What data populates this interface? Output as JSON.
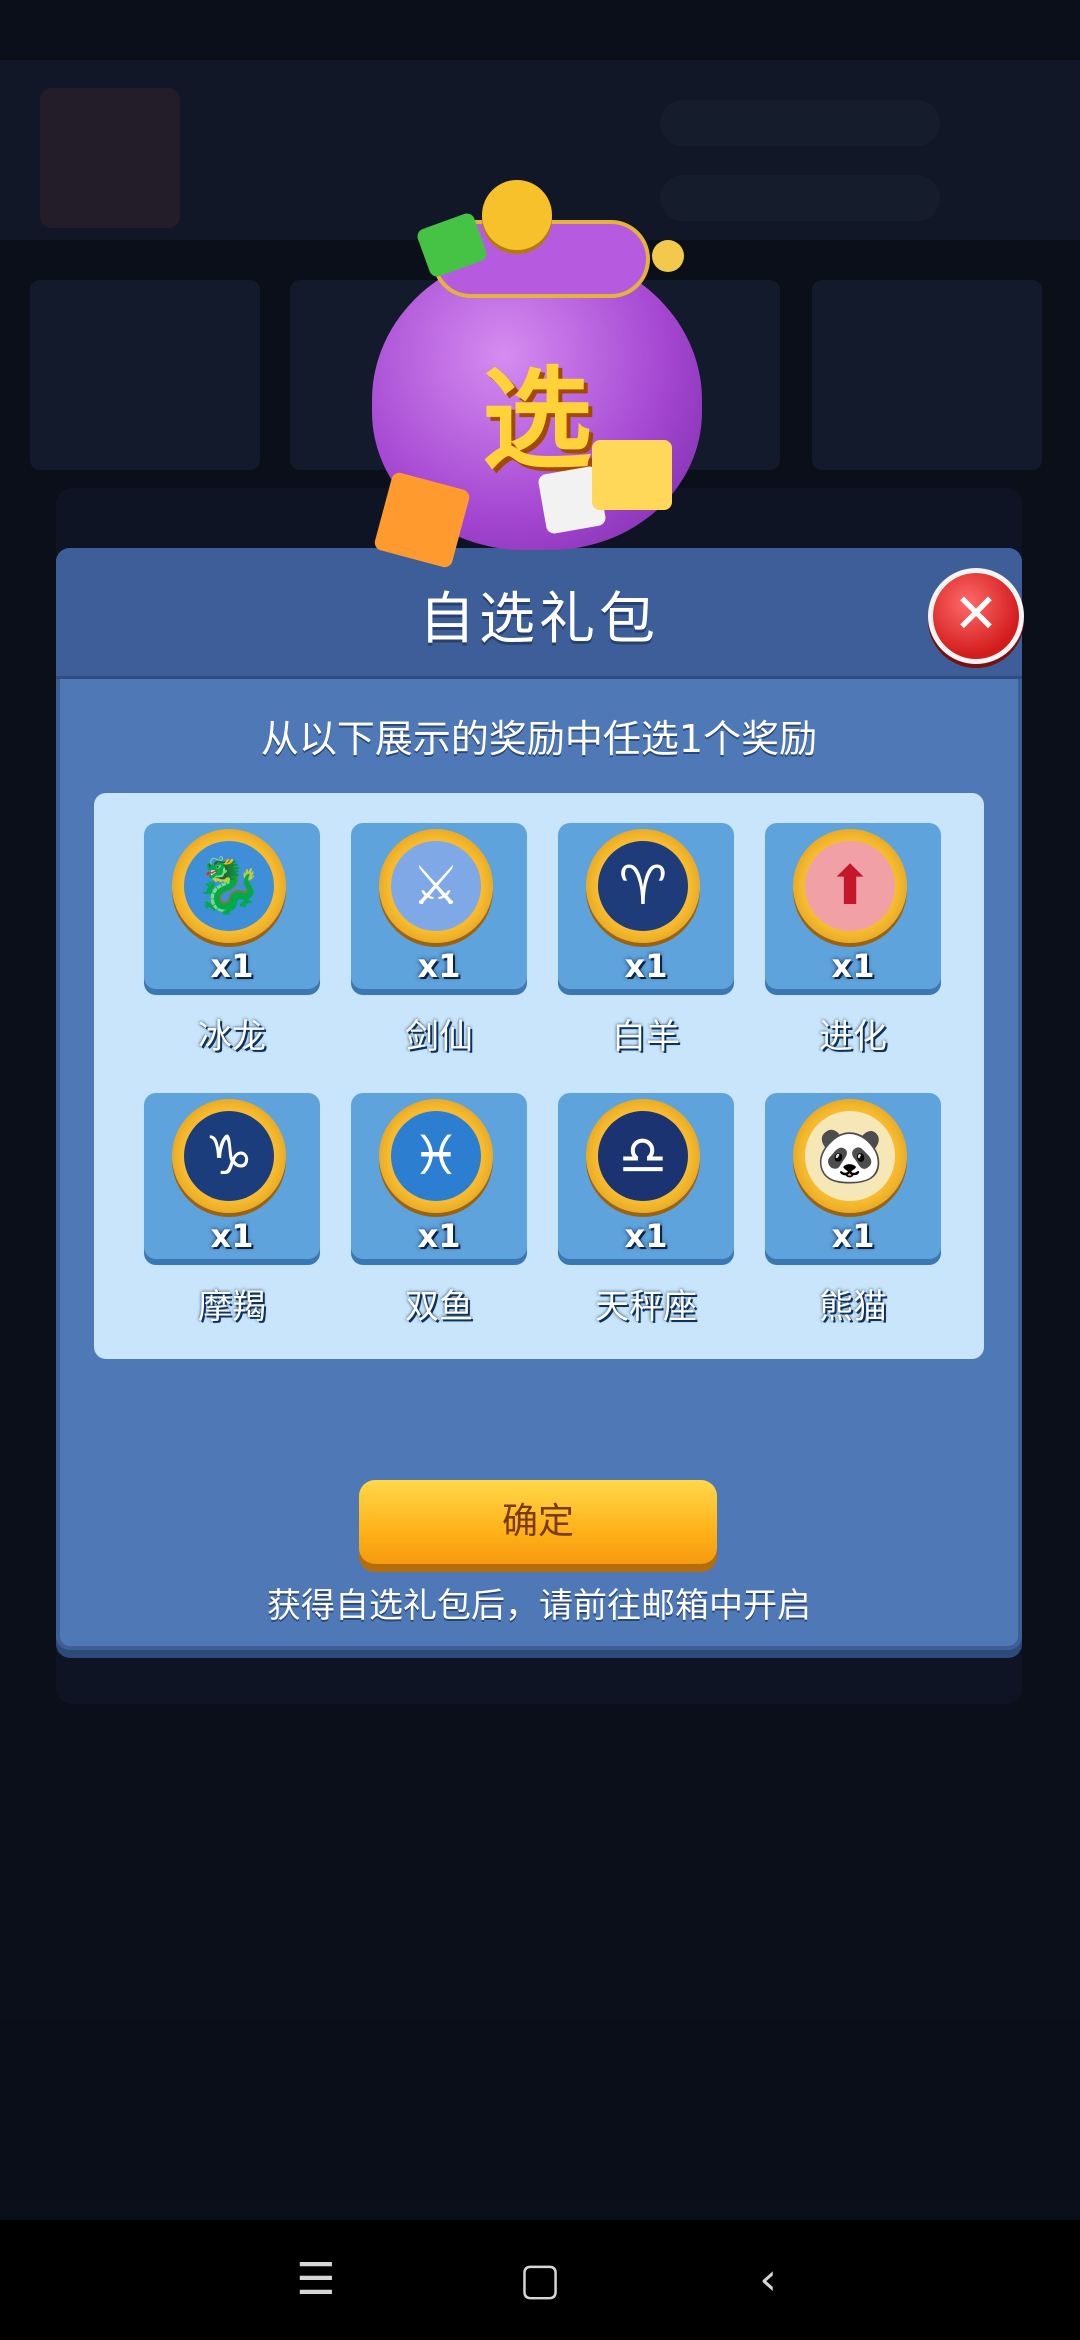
{
  "dialog": {
    "title": "自选礼包",
    "subtitle": "从以下展示的奖励中任选1个奖励",
    "confirm_label": "确定",
    "footnote": "获得自选礼包后，请前往邮箱中开启",
    "close_icon": "close-icon",
    "pouch_char": "选"
  },
  "rewards": [
    {
      "name": "冰龙",
      "qty": "x1",
      "icon": "ice-dragon-icon",
      "glyph": "🐉",
      "color": "#3f8fd8"
    },
    {
      "name": "剑仙",
      "qty": "x1",
      "icon": "sword-immortal-icon",
      "glyph": "⚔",
      "color": "#7fa8e6"
    },
    {
      "name": "白羊",
      "qty": "x1",
      "icon": "aries-icon",
      "glyph": "♈",
      "color": "#1e3b7a"
    },
    {
      "name": "进化",
      "qty": "x1",
      "icon": "evolution-icon",
      "glyph": "⬆",
      "color": "#f1a0a6"
    },
    {
      "name": "摩羯",
      "qty": "x1",
      "icon": "capricorn-icon",
      "glyph": "♑",
      "color": "#1c3d7b"
    },
    {
      "name": "双鱼",
      "qty": "x1",
      "icon": "pisces-icon",
      "glyph": "♓",
      "color": "#2c7fd0"
    },
    {
      "name": "天秤座",
      "qty": "x1",
      "icon": "libra-icon",
      "glyph": "♎",
      "color": "#1b3370"
    },
    {
      "name": "熊猫",
      "qty": "x1",
      "icon": "panda-icon",
      "glyph": "🐼",
      "color": "#f6e7b7"
    }
  ],
  "system_nav": {
    "menu_icon": "☰",
    "home_icon": "▢",
    "back_icon": "‹"
  }
}
